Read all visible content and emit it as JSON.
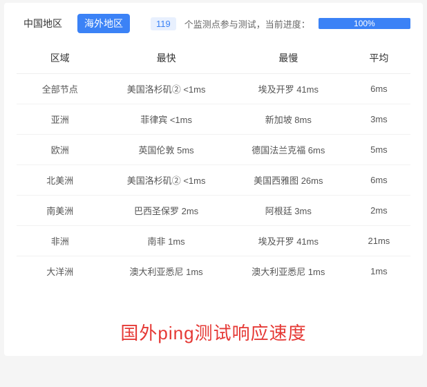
{
  "tabs": {
    "china": "中国地区",
    "overseas": "海外地区"
  },
  "status": {
    "count": "119",
    "text_before": "个监测点参与测试，当前进度：",
    "progress_label": "100%"
  },
  "table": {
    "headers": {
      "region": "区域",
      "fastest": "最快",
      "slowest": "最慢",
      "average": "平均"
    },
    "rows": [
      {
        "region": "全部节点",
        "fastest": "美国洛杉矶② <1ms",
        "slowest": "埃及开罗 41ms",
        "average": "6ms"
      },
      {
        "region": "亚洲",
        "fastest": "菲律宾 <1ms",
        "slowest": "新加坡 8ms",
        "average": "3ms"
      },
      {
        "region": "欧洲",
        "fastest": "英国伦敦 5ms",
        "slowest": "德国法兰克福 6ms",
        "average": "5ms"
      },
      {
        "region": "北美洲",
        "fastest": "美国洛杉矶② <1ms",
        "slowest": "美国西雅图 26ms",
        "average": "6ms"
      },
      {
        "region": "南美洲",
        "fastest": "巴西圣保罗 2ms",
        "slowest": "阿根廷 3ms",
        "average": "2ms"
      },
      {
        "region": "非洲",
        "fastest": "南非 1ms",
        "slowest": "埃及开罗 41ms",
        "average": "21ms"
      },
      {
        "region": "大洋洲",
        "fastest": "澳大利亚悉尼 1ms",
        "slowest": "澳大利亚悉尼 1ms",
        "average": "1ms"
      }
    ]
  },
  "caption": "国外ping测试响应速度"
}
